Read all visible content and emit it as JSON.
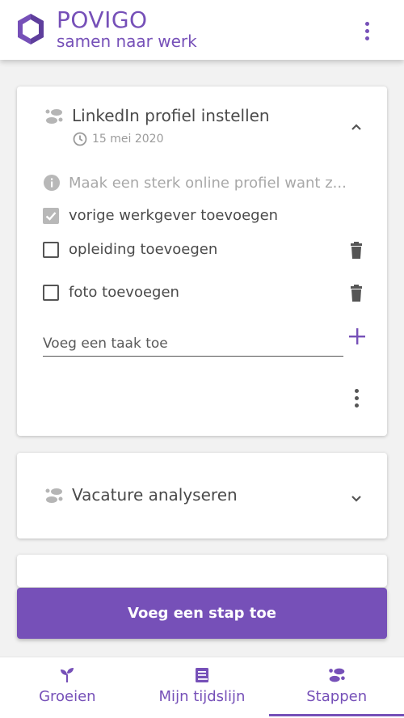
{
  "app": {
    "name": "POVIGO",
    "tagline": "samen naar werk"
  },
  "colors": {
    "primary": "#7650b8",
    "card_background": "#ffffff",
    "page_background": "#f2f2f2"
  },
  "steps": [
    {
      "title": "LinkedIn profiel instellen",
      "date": "15 mei 2020",
      "expanded": true,
      "description": "Maak een sterk online profiel want z...",
      "tasks": [
        {
          "label": "vorige werkgever toevoegen",
          "checked": true
        },
        {
          "label": "opleiding toevoegen",
          "checked": false
        },
        {
          "label": "foto toevoegen",
          "checked": false
        }
      ],
      "add_task_placeholder": "Voeg een taak toe"
    },
    {
      "title": "Vacature analyseren",
      "expanded": false
    }
  ],
  "add_step_label": "Voeg een stap toe",
  "bottom_nav": [
    {
      "label": "Groeien",
      "icon": "sprout-icon",
      "active": false
    },
    {
      "label": "Mijn tijdslijn",
      "icon": "book-icon",
      "active": false
    },
    {
      "label": "Stappen",
      "icon": "footsteps-icon",
      "active": true
    }
  ]
}
